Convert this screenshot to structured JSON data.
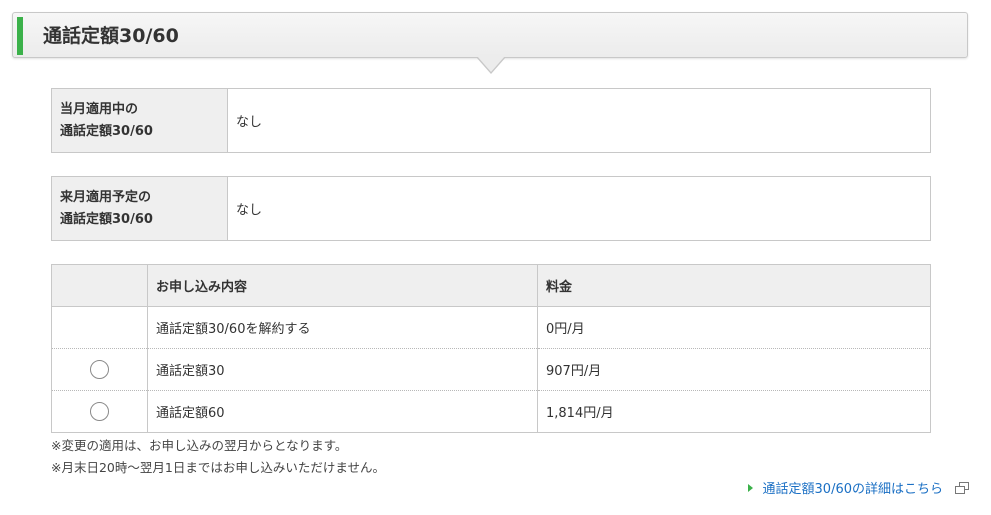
{
  "section": {
    "title": "通話定額30/60"
  },
  "current_month": {
    "label_line1": "当月適用中の",
    "label_line2": "通話定額30/60",
    "value": "なし"
  },
  "next_month": {
    "label_line1": "来月適用予定の",
    "label_line2": "通話定額30/60",
    "value": "なし"
  },
  "plans": {
    "headers": {
      "select": "",
      "content": "お申し込み内容",
      "fee": "料金"
    },
    "rows": [
      {
        "name": "通話定額30/60を解約する",
        "fee": "0円/月",
        "has_radio": false
      },
      {
        "name": "通話定額30",
        "fee": "907円/月",
        "has_radio": true
      },
      {
        "name": "通話定額60",
        "fee": "1,814円/月",
        "has_radio": true
      }
    ]
  },
  "notes": [
    "※変更の適用は、お申し込みの翌月からとなります。",
    "※月末日20時～翌月1日まではお申し込みいただけません。"
  ],
  "detail_link": {
    "label": "通話定額30/60の詳細はこちら",
    "icon": "external-window-icon"
  },
  "colors": {
    "accent_green": "#3bb14a",
    "link_blue": "#1a6fc4",
    "header_bg": "#efefef"
  }
}
